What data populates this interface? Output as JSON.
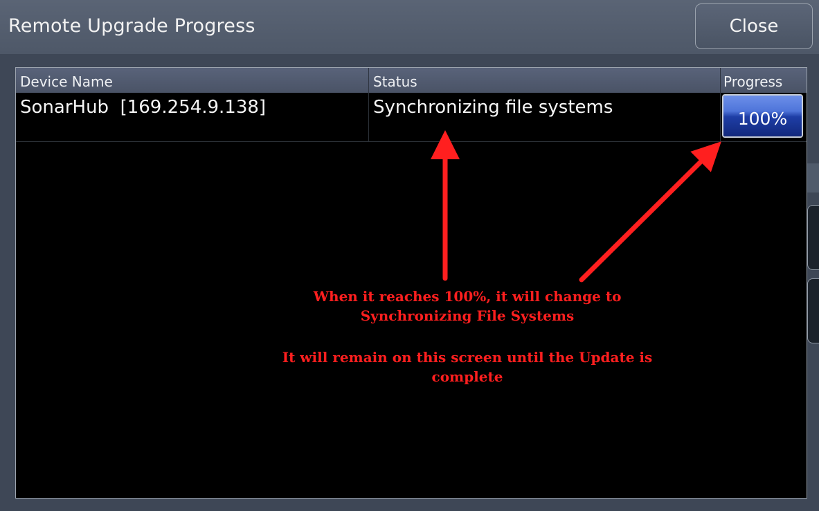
{
  "window": {
    "title": "Remote Upgrade Progress",
    "close_label": "Close"
  },
  "table": {
    "columns": [
      "Device Name",
      "Status",
      "Progress"
    ],
    "rows": [
      {
        "device_name": "SonarHub  [169.254.9.138]",
        "status": "Synchronizing file systems",
        "progress_text": "100%",
        "progress_value": 100
      }
    ]
  },
  "annotations": {
    "note1_line1": "When it reaches 100%, it will change to",
    "note1_line2": "Synchronizing File Systems",
    "note2_line1": "It will remain on this screen until the Update is",
    "note2_line2": "complete",
    "color": "#ff1f1f"
  }
}
